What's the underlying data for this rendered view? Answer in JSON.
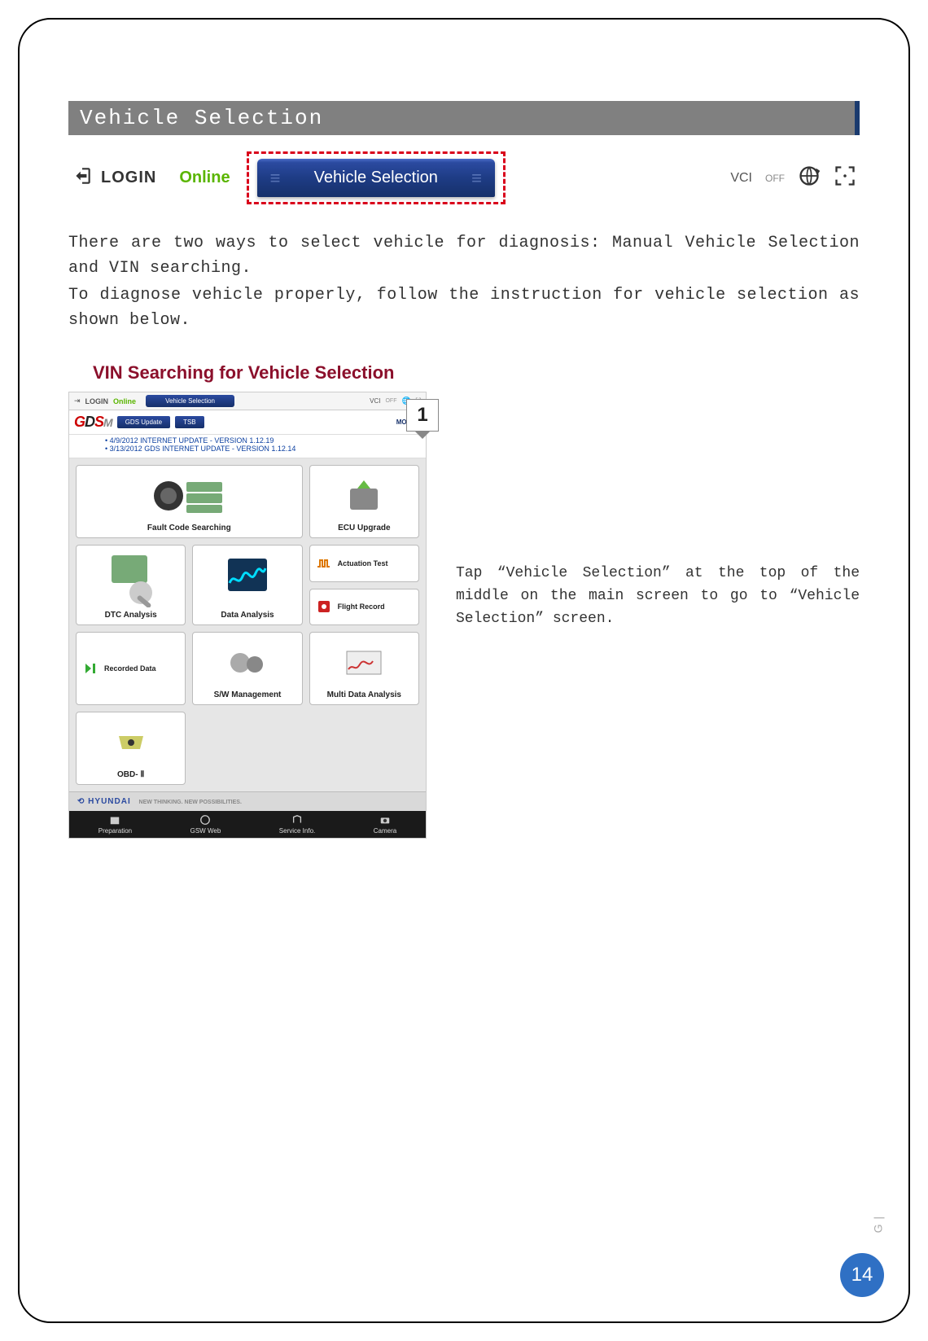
{
  "section_title": "Vehicle Selection",
  "toolbar": {
    "login_label": "LOGIN",
    "online_label": "Online",
    "vehicle_selection_label": "Vehicle Selection",
    "vci_label": "VCI",
    "vci_status": "OFF"
  },
  "intro_para_1": "There are two ways to select vehicle for diagnosis: Manual Vehicle Selection and VIN searching.",
  "intro_para_2": "To diagnose vehicle properly, follow the instruction for vehicle selection as shown below.",
  "subheading": "VIN Searching for Vehicle Selection",
  "step_number": "1",
  "screenshot": {
    "top": {
      "login": "LOGIN",
      "online": "Online",
      "vsel": "Vehicle Selection",
      "vci": "VCI",
      "vci_status": "OFF"
    },
    "logo": {
      "g": "G",
      "d": "D",
      "s": "S",
      "m": "M"
    },
    "tabs": {
      "update": "GDS Update",
      "tsb": "TSB",
      "more": "MORE ▸"
    },
    "updates": {
      "line1": "• 4/9/2012 INTERNET UPDATE - VERSION 1.12.19",
      "line2": "• 3/13/2012 GDS INTERNET UPDATE - VERSION 1.12.14"
    },
    "tiles": {
      "fault_code": "Fault Code Searching",
      "ecu_upgrade": "ECU Upgrade",
      "actuation_test": "Actuation Test",
      "flight_record": "Flight Record",
      "dtc_analysis": "DTC Analysis",
      "data_analysis": "Data Analysis",
      "recorded_data": "Recorded Data",
      "sw_management": "S/W Management",
      "multi_data": "Multi Data Analysis",
      "obd2": "OBD- Ⅱ"
    },
    "brand_bar": "HYUNDAI",
    "brand_tag": "NEW THINKING. NEW POSSIBILITIES.",
    "bottom_nav": {
      "preparation": "Preparation",
      "gsw_web": "GSW Web",
      "service_info": "Service Info.",
      "camera": "Camera"
    }
  },
  "instruction_text": "Tap “Vehicle Selection” at the top of the middle on the main screen to go to “Vehicle Selection” screen.",
  "side_label": "G |",
  "page_number": "14"
}
